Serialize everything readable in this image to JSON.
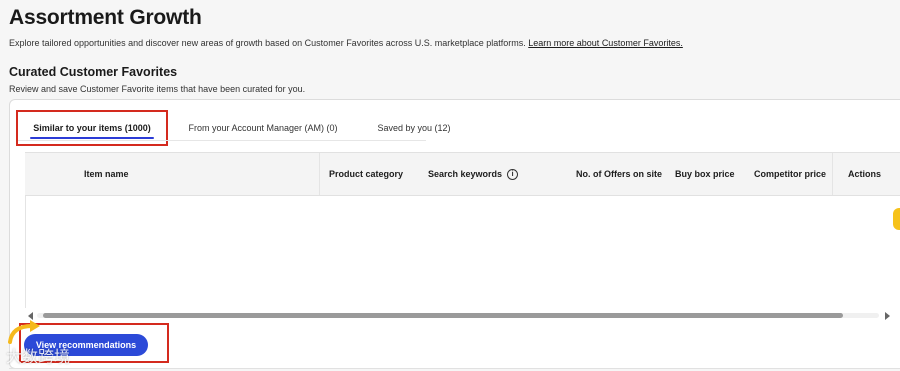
{
  "header": {
    "title": "Assortment Growth",
    "description": "Explore tailored opportunities and discover new areas of growth based on Customer Favorites across U.S. marketplace platforms.",
    "learn_more_link": "Learn more about Customer Favorites."
  },
  "curated": {
    "title": "Curated Customer Favorites",
    "description": "Review and save Customer Favorite items that have been curated for you."
  },
  "tabs": [
    {
      "label": "Similar to your items (1000)",
      "active": true
    },
    {
      "label": "From your Account Manager (AM) (0)",
      "active": false
    },
    {
      "label": "Saved by you (12)",
      "active": false
    }
  ],
  "table": {
    "columns": [
      "Item name",
      "Product category",
      "Search keywords",
      "No. of Offers on site",
      "Buy box price",
      "Competitor price",
      "Actions"
    ],
    "rows": []
  },
  "actions": {
    "view_recommendations": "View recommendations"
  },
  "watermark": {
    "text": "大数跨境"
  },
  "colors": {
    "primary": "#2c4ad8",
    "highlight_box": "#d42a1e",
    "tab_underline": "#2b3bd6",
    "side_marker": "#f6c21a"
  }
}
